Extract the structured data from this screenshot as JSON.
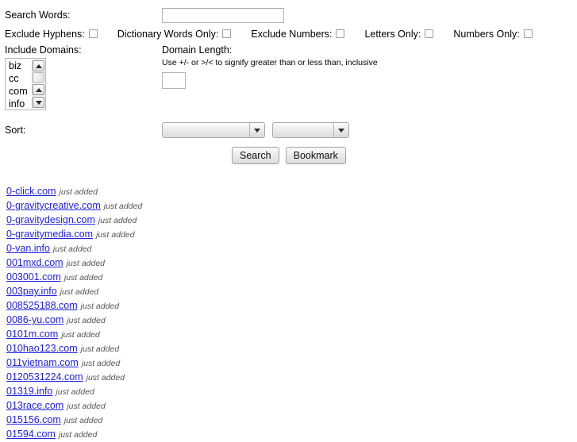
{
  "form": {
    "search_label": "Search Words:",
    "search_value": "",
    "search_placeholder": "",
    "checkboxes": [
      {
        "label": "Exclude Hyphens:",
        "checked": false
      },
      {
        "label": "Dictionary Words Only:",
        "checked": false
      },
      {
        "label": "Exclude Numbers:",
        "checked": false
      },
      {
        "label": "Letters Only:",
        "checked": false
      },
      {
        "label": "Numbers Only:",
        "checked": false
      }
    ],
    "include_domains_label": "Include Domains:",
    "include_domains_options": [
      "biz",
      "cc",
      "com",
      "info"
    ],
    "domain_length_label": "Domain Length:",
    "domain_length_hint": "Use +/- or >/< to signify greater than or less than, inclusive",
    "domain_length_value": "",
    "sort_label": "Sort:",
    "sort_primary_value": "",
    "sort_secondary_value": "",
    "search_button": "Search",
    "bookmark_button": "Bookmark"
  },
  "results": {
    "tag": "just added",
    "items": [
      "0-click.com",
      "0-gravitycreative.com",
      "0-gravitydesign.com",
      "0-gravitymedia.com",
      "0-van.info",
      "001mxd.com",
      "003001.com",
      "003pay.info",
      "008525188.com",
      "0086-yu.com",
      "0101m.com",
      "010hao123.com",
      "011vietnam.com",
      "0120531224.com",
      "01319.info",
      "013race.com",
      "015156.com",
      "01594.com"
    ]
  },
  "colors": {
    "link": "#2222dd",
    "tag": "#555555",
    "background": "#ffffff"
  }
}
